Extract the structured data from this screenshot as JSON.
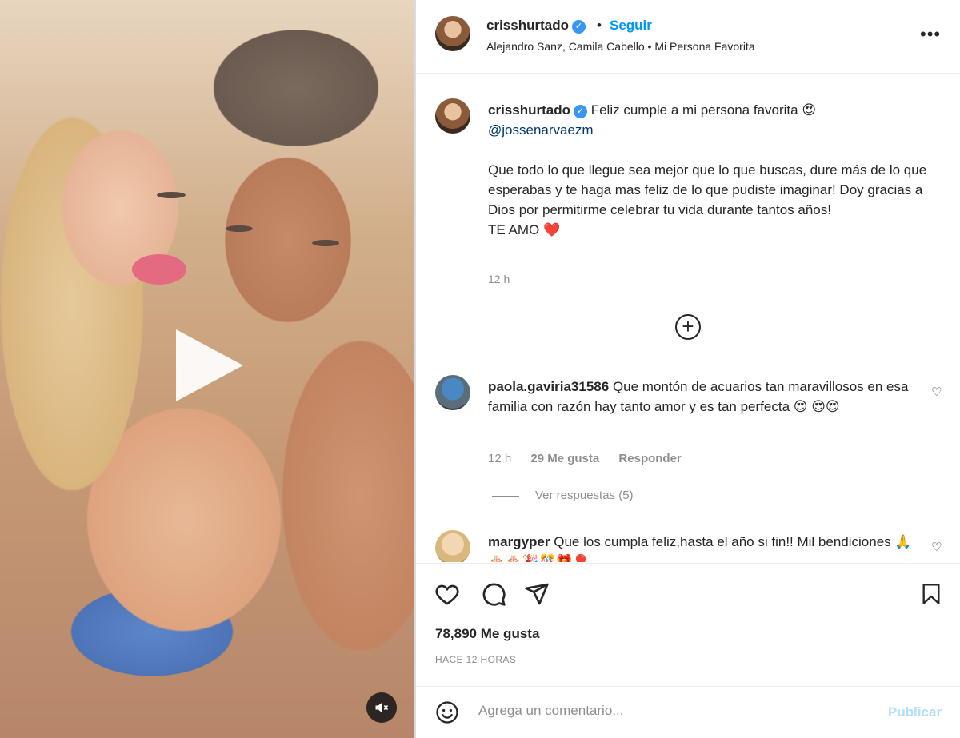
{
  "post": {
    "username": "crisshurtado",
    "verified_badge": "✓",
    "separator": "•",
    "follow_label": "Seguir",
    "music": "Alejandro Sanz, Camila Cabello • Mi Persona Favorita",
    "more_label": "•••"
  },
  "caption": {
    "username": "crisshurtado",
    "line1": "Feliz cumple a mi persona favorita 😍",
    "mention": "@jossenarvaezm",
    "body": "Que todo lo que llegue sea mejor que lo que buscas, dure más de lo que esperabas y te haga mas feliz de lo que pudiste imaginar! Doy gracias a Dios por permitirme celebrar tu vida durante tantos años!",
    "closing": "TE AMO ❤️",
    "time": "12 h"
  },
  "load_more_icon": "plus-circle-icon",
  "comments": [
    {
      "username": "paola.gaviria31586",
      "text": "Que montón de acuarios tan maravillosos en esa familia con razón hay tanto amor y es tan perfecta 😍 😍😍",
      "time": "12 h",
      "likes": "29 Me gusta",
      "reply_label": "Responder",
      "view_replies": "Ver respuestas (5)"
    },
    {
      "username": "margyper",
      "text": "Que los cumpla feliz,hasta el año si fin!! Mil bendiciones 🙏🎂🎂🎉🎊🎁🎈"
    }
  ],
  "actions": {
    "like_icon": "heart-icon",
    "comment_icon": "comment-icon",
    "share_icon": "send-icon",
    "save_icon": "bookmark-icon"
  },
  "likes_count": "78,890 Me gusta",
  "time_ago": "HACE 12 HORAS",
  "composer": {
    "emoji_icon": "emoji-icon",
    "placeholder": "Agrega un comentario...",
    "publish_label": "Publicar"
  },
  "video": {
    "play_icon": "play-icon",
    "mute_icon": "mute-icon"
  },
  "colors": {
    "accent": "#0095f6",
    "verified": "#3897f0",
    "muted_text": "#8e8e8e",
    "publish_disabled": "#b2dffc"
  }
}
